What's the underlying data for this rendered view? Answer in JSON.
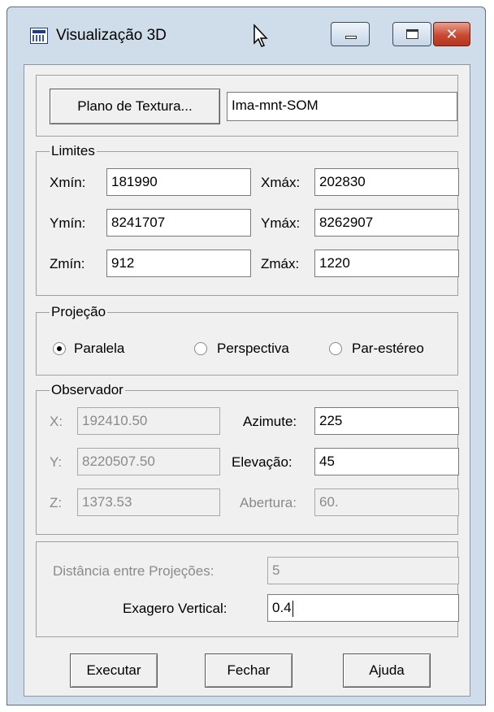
{
  "window": {
    "title": "Visualização 3D",
    "close_glyph": "✕"
  },
  "texture": {
    "button_label": "Plano de Textura...",
    "value": "Ima-mnt-SOM"
  },
  "limits": {
    "legend": "Limites",
    "xmin_label": "Xmín:",
    "xmin": "181990",
    "xmax_label": "Xmáx:",
    "xmax": "202830",
    "ymin_label": "Ymín:",
    "ymin": "8241707",
    "ymax_label": "Ymáx:",
    "ymax": "8262907",
    "zmin_label": "Zmín:",
    "zmin": "912",
    "zmax_label": "Zmáx:",
    "zmax": "1220"
  },
  "projection": {
    "legend": "Projeção",
    "options": [
      "Paralela",
      "Perspectiva",
      "Par-estéreo"
    ],
    "selected": "Paralela"
  },
  "observer": {
    "legend": "Observador",
    "x_label": "X:",
    "x": "192410.50",
    "y_label": "Y:",
    "y": "8220507.50",
    "z_label": "Z:",
    "z": "1373.53",
    "azimute_label": "Azimute:",
    "azimute": "225",
    "elevacao_label": "Elevação:",
    "elevacao": "45",
    "abertura_label": "Abertura:",
    "abertura": "60."
  },
  "extra": {
    "distancia_label": "Distância entre Projeções:",
    "distancia": "5",
    "exagero_label": "Exagero Vertical:",
    "exagero": "0.4"
  },
  "buttons": {
    "executar": "Executar",
    "fechar": "Fechar",
    "ajuda": "Ajuda"
  }
}
